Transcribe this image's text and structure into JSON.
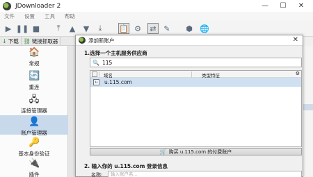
{
  "window": {
    "title": "JDownloader 2",
    "controls": [
      "—",
      "☐",
      "✕"
    ]
  },
  "menu": [
    "文件",
    "设置",
    "工具",
    "帮助"
  ],
  "tabs": [
    {
      "icon": "↓",
      "label": "下载"
    },
    {
      "icon": "⛓",
      "label": "链接抓取器"
    }
  ],
  "sidebar": [
    {
      "icon": "home-icon",
      "label": "常规"
    },
    {
      "icon": "reconnect-icon",
      "label": "重连"
    },
    {
      "icon": "connection-manager-icon",
      "label": "连接管理器"
    },
    {
      "icon": "account-manager-icon",
      "label": "账户管理器",
      "active": true
    },
    {
      "icon": "basic-auth-icon",
      "label": "基本身份验证"
    },
    {
      "icon": "plugin-icon",
      "label": "插件"
    }
  ],
  "dialog": {
    "title": "添加新账户",
    "step1": "1.选择一个主机服务供应商",
    "search_value": "115",
    "table": {
      "headers": [
        "域名",
        "类型特征"
      ],
      "rows": [
        {
          "domain": "u.115.com"
        }
      ]
    },
    "buy_button": "购买 u.115.com 的付费账户",
    "step2": "2. 输入你的 u.115.com 登录信息",
    "name_label": "名称:",
    "name_placeholder": "输入账户名..."
  }
}
